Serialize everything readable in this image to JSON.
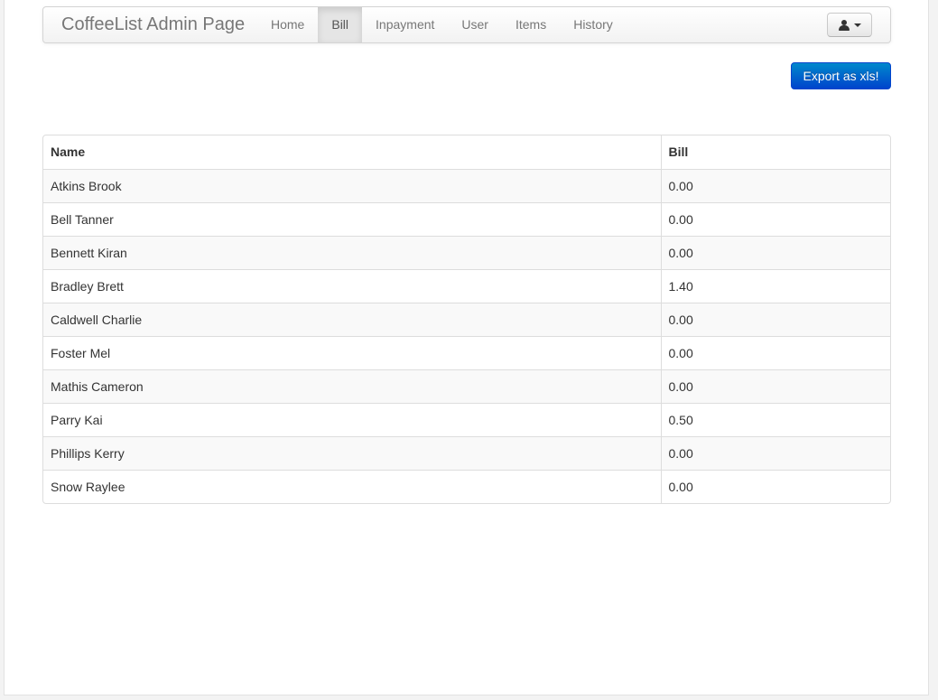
{
  "navbar": {
    "brand": "CoffeeList Admin Page",
    "items": [
      {
        "label": "Home",
        "active": false
      },
      {
        "label": "Bill",
        "active": true
      },
      {
        "label": "Inpayment",
        "active": false
      },
      {
        "label": "User",
        "active": false
      },
      {
        "label": "Items",
        "active": false
      },
      {
        "label": "History",
        "active": false
      }
    ],
    "user_menu_icon": "user-icon"
  },
  "actions": {
    "export_label": "Export as xls!"
  },
  "table": {
    "headers": [
      "Name",
      "Bill"
    ],
    "rows": [
      {
        "name": "Atkins Brook",
        "bill": "0.00"
      },
      {
        "name": "Bell Tanner",
        "bill": "0.00"
      },
      {
        "name": "Bennett Kiran",
        "bill": "0.00"
      },
      {
        "name": "Bradley Brett",
        "bill": "1.40"
      },
      {
        "name": "Caldwell Charlie",
        "bill": "0.00"
      },
      {
        "name": "Foster Mel",
        "bill": "0.00"
      },
      {
        "name": "Mathis Cameron",
        "bill": "0.00"
      },
      {
        "name": "Parry Kai",
        "bill": "0.50"
      },
      {
        "name": "Phillips Kerry",
        "bill": "0.00"
      },
      {
        "name": "Snow Raylee",
        "bill": "0.00"
      }
    ]
  },
  "colors": {
    "primary_button": "#0070cc",
    "active_nav_bg": "#e5e5e5",
    "striped_row_bg": "#f9f9f9"
  }
}
